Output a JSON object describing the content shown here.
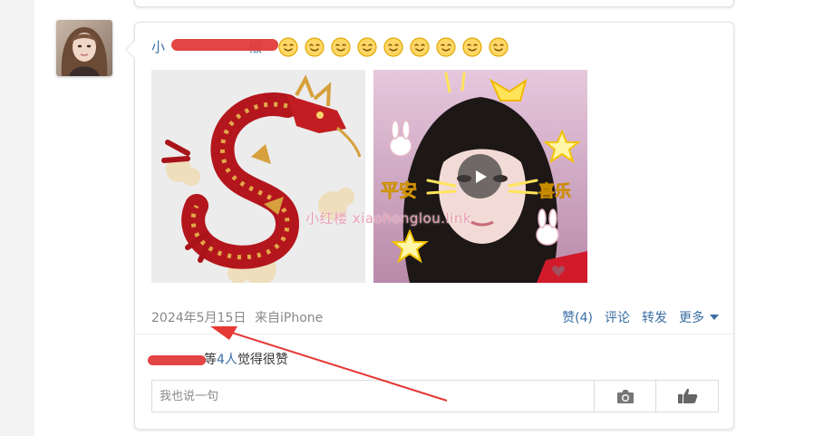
{
  "post": {
    "username_tail": "椒",
    "emoji_count": 9,
    "watermark": "小红楼 xiaohonglou.link",
    "date": "2024年5月15日",
    "source": "来自iPhone",
    "actions": {
      "like": "赞(4)",
      "comment": "评论",
      "repost": "转发",
      "more": "更多"
    }
  },
  "likes": {
    "prefix": "等",
    "count": "4人",
    "suffix": "觉得很赞"
  },
  "comment": {
    "placeholder": "我也说一句"
  },
  "icons": {
    "emoji": "smiley-face-icon",
    "play": "play-icon",
    "camera": "camera-icon",
    "like": "thumb-up-icon",
    "more_caret": "caret-down-icon"
  },
  "colors": {
    "link": "#3a6ea5",
    "meta": "#888888",
    "redaction": "#e23a3a",
    "annotation_arrow": "#e53935"
  }
}
